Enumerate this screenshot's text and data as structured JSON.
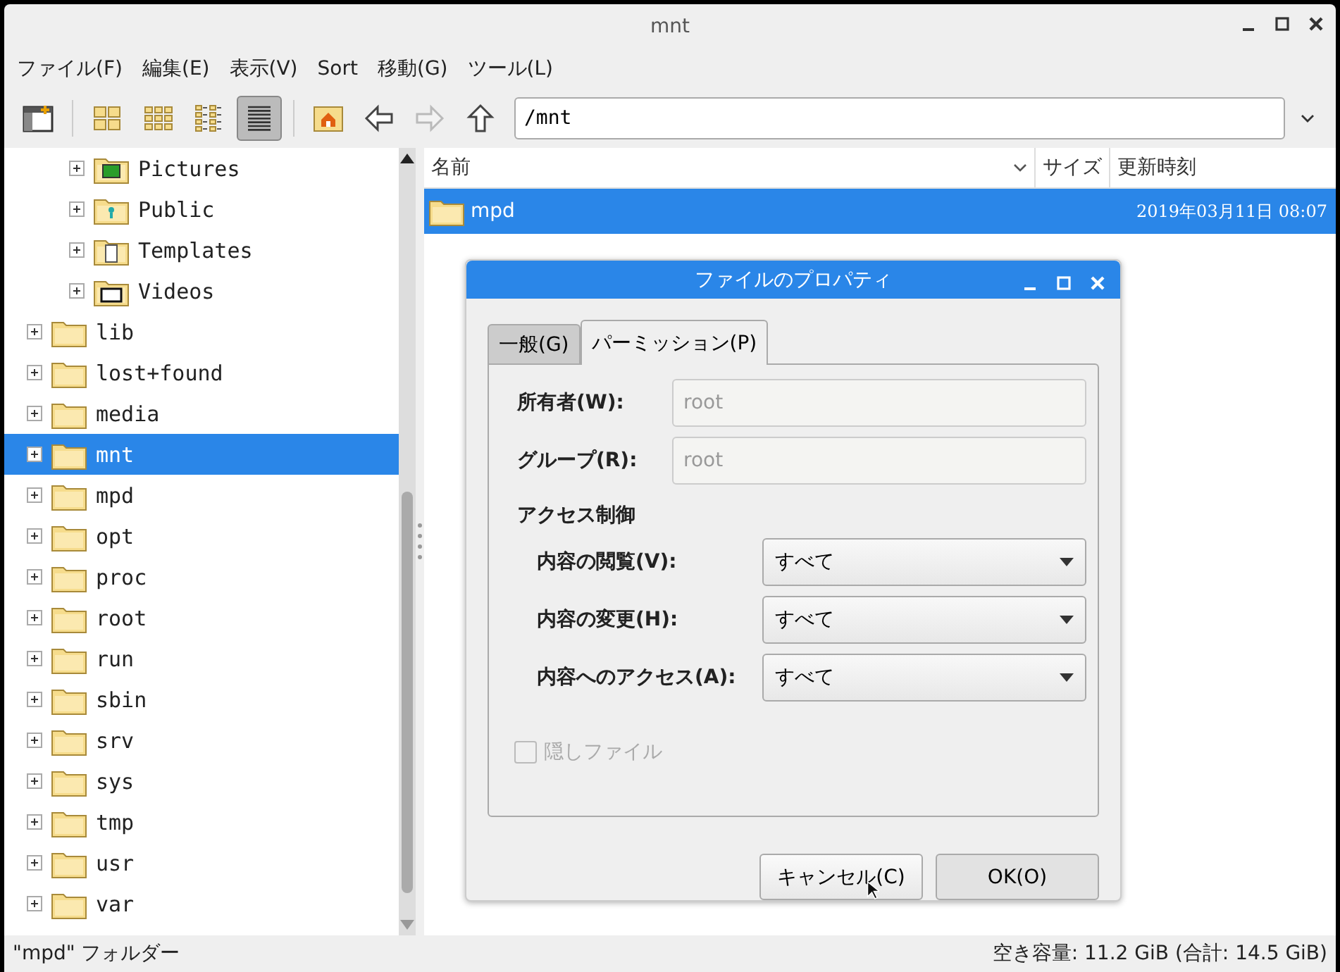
{
  "window": {
    "title": "mnt"
  },
  "menu": [
    "ファイル(F)",
    "編集(E)",
    "表示(V)",
    "Sort",
    "移動(G)",
    "ツール(L)"
  ],
  "toolbar": [
    {
      "kind": "new-window"
    },
    {
      "kind": "sep"
    },
    {
      "kind": "icon-view",
      "selected": false
    },
    {
      "kind": "thumb-view",
      "selected": false
    },
    {
      "kind": "compact-view",
      "selected": false
    },
    {
      "kind": "list-view",
      "selected": true
    },
    {
      "kind": "sep"
    },
    {
      "kind": "home"
    },
    {
      "kind": "back",
      "disabled": false
    },
    {
      "kind": "forward",
      "disabled": true
    },
    {
      "kind": "up",
      "disabled": false
    }
  ],
  "location": {
    "value": "/mnt"
  },
  "tree": [
    {
      "children": [
        {
          "label": "Pictures",
          "kind": "pictures",
          "expanded": false,
          "selected": false
        },
        {
          "label": "Public",
          "kind": "public",
          "expanded": false,
          "selected": false
        },
        {
          "label": "Templates",
          "kind": "templates",
          "expanded": false,
          "selected": false
        },
        {
          "label": "Videos",
          "kind": "videos",
          "expanded": false,
          "selected": false
        }
      ]
    },
    {
      "label": "lib",
      "kind": "folder",
      "expanded": false,
      "selected": false
    },
    {
      "label": "lost+found",
      "kind": "folder",
      "expanded": false,
      "selected": false
    },
    {
      "label": "media",
      "kind": "folder",
      "expanded": false,
      "selected": false
    },
    {
      "label": "mnt",
      "kind": "folder",
      "expanded": false,
      "selected": true
    },
    {
      "label": "mpd",
      "kind": "folder",
      "expanded": false,
      "selected": false
    },
    {
      "label": "opt",
      "kind": "folder",
      "expanded": false,
      "selected": false
    },
    {
      "label": "proc",
      "kind": "folder",
      "expanded": false,
      "selected": false
    },
    {
      "label": "root",
      "kind": "folder",
      "expanded": false,
      "selected": false
    },
    {
      "label": "run",
      "kind": "folder",
      "expanded": false,
      "selected": false
    },
    {
      "label": "sbin",
      "kind": "folder",
      "expanded": false,
      "selected": false
    },
    {
      "label": "srv",
      "kind": "folder",
      "expanded": false,
      "selected": false
    },
    {
      "label": "sys",
      "kind": "folder",
      "expanded": false,
      "selected": false
    },
    {
      "label": "tmp",
      "kind": "folder",
      "expanded": false,
      "selected": false
    },
    {
      "label": "usr",
      "kind": "folder",
      "expanded": false,
      "selected": false
    },
    {
      "label": "var",
      "kind": "folder",
      "expanded": false,
      "selected": false
    }
  ],
  "table": {
    "columns": [
      "名前",
      "サイズ",
      "更新時刻"
    ],
    "rows": [
      {
        "name": "mpd",
        "size": "",
        "modified": "2019年03月11日 08:07",
        "selected": true
      }
    ]
  },
  "status_bar": {
    "left": "\"mpd\" フォルダー",
    "right": "空き容量: 11.2 GiB (合計: 14.5 GiB)"
  },
  "dialog": {
    "title": "ファイルのプロパティ",
    "tabs": [
      {
        "label": "一般(G)",
        "selected": false
      },
      {
        "label": "パーミッション(P)",
        "selected": true
      }
    ],
    "owner": {
      "label": "所有者(W):",
      "value": "root"
    },
    "group": {
      "label": "グループ(R):",
      "value": "root"
    },
    "access_heading": "アクセス制御",
    "access": [
      {
        "label": "内容の閲覧(V):",
        "value": "すべて"
      },
      {
        "label": "内容の変更(H):",
        "value": "すべて"
      },
      {
        "label": "内容へのアクセス(A):",
        "value": "すべて"
      }
    ],
    "hidden_file": {
      "label": "隠しファイル",
      "checked": false,
      "disabled": true
    },
    "buttons": [
      "キャンセル(C)",
      "OK(O)"
    ]
  }
}
